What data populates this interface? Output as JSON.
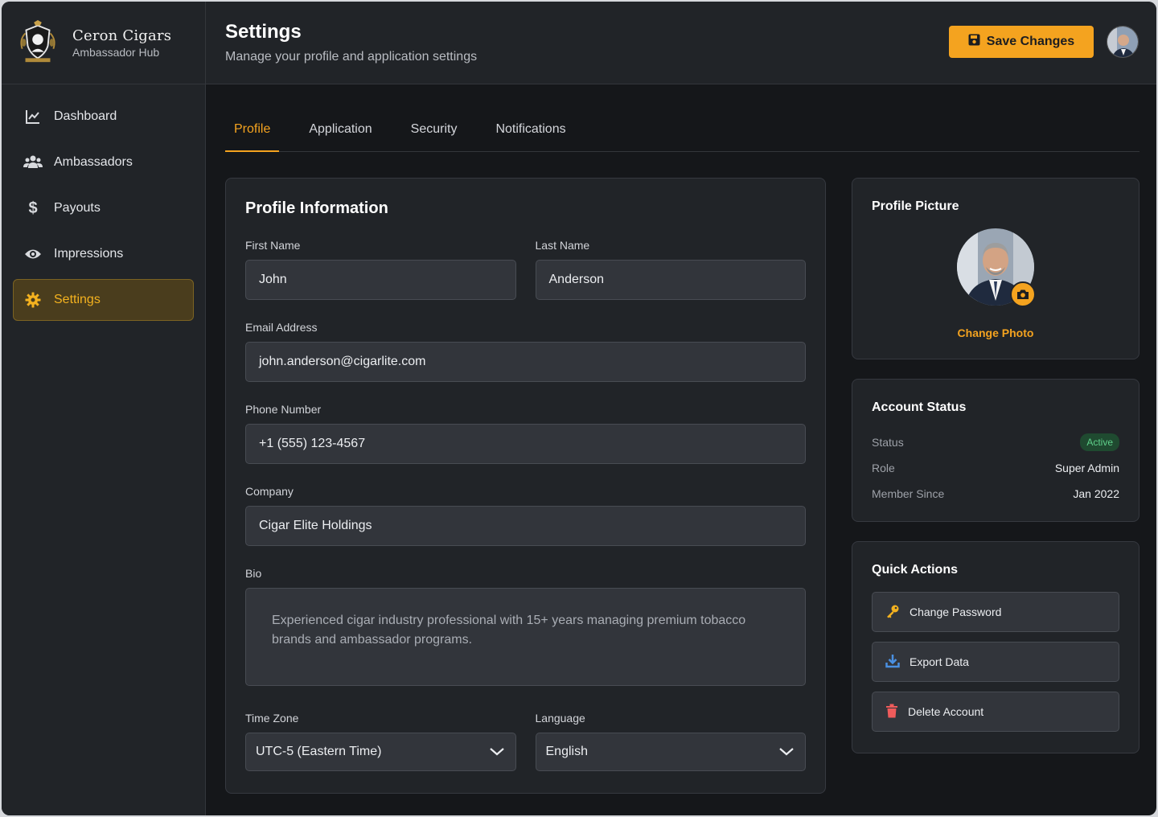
{
  "brand": {
    "name": "Ceron Cigars",
    "subtitle": "Ambassador Hub"
  },
  "sidebar": {
    "items": [
      {
        "label": "Dashboard",
        "icon": "chart-line-icon"
      },
      {
        "label": "Ambassadors",
        "icon": "users-icon"
      },
      {
        "label": "Payouts",
        "icon": "dollar-icon"
      },
      {
        "label": "Impressions",
        "icon": "eye-icon"
      },
      {
        "label": "Settings",
        "icon": "gear-icon",
        "active": true
      }
    ]
  },
  "header": {
    "title": "Settings",
    "subtitle": "Manage your profile and application settings",
    "save_label": "Save Changes"
  },
  "tabs": [
    {
      "label": "Profile",
      "active": true
    },
    {
      "label": "Application"
    },
    {
      "label": "Security"
    },
    {
      "label": "Notifications"
    }
  ],
  "profile": {
    "title": "Profile Information",
    "first_name_label": "First Name",
    "first_name": "John",
    "last_name_label": "Last Name",
    "last_name": "Anderson",
    "email_label": "Email Address",
    "email": "john.anderson@cigarlite.com",
    "phone_label": "Phone Number",
    "phone": "+1 (555) 123-4567",
    "company_label": "Company",
    "company": "Cigar Elite Holdings",
    "bio_label": "Bio",
    "bio": "Experienced cigar industry professional with 15+ years managing premium tobacco brands and ambassador programs.",
    "timezone_label": "Time Zone",
    "timezone": "UTC-5 (Eastern Time)",
    "language_label": "Language",
    "language": "English"
  },
  "picture": {
    "title": "Profile Picture",
    "change_label": "Change Photo"
  },
  "account_status": {
    "title": "Account Status",
    "status_label": "Status",
    "status": "Active",
    "role_label": "Role",
    "role": "Super Admin",
    "member_since_label": "Member Since",
    "member_since": "Jan 2022"
  },
  "quick_actions": {
    "title": "Quick Actions",
    "change_password": "Change Password",
    "export_data": "Export Data",
    "delete_account": "Delete Account"
  },
  "colors": {
    "accent": "#f4a31f",
    "active_badge": "#5fd08a",
    "danger": "#ef5b5b",
    "info": "#4a90e2"
  }
}
